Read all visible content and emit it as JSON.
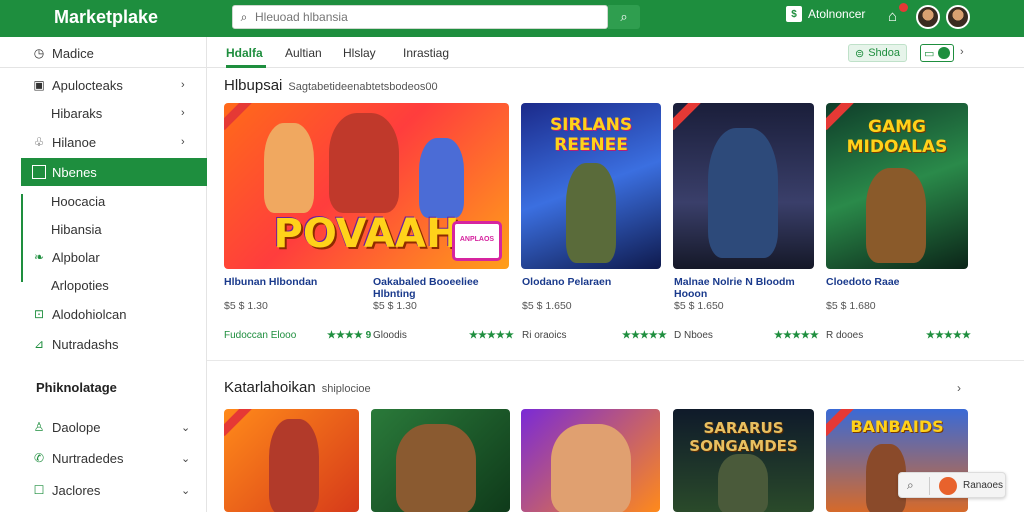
{
  "header": {
    "logo": "Marketplake",
    "search_placeholder": "Hleuoad hlbansia",
    "right_label": "Atolnoncer",
    "right_box": "$"
  },
  "sidebar": {
    "items": [
      {
        "label": "Madice",
        "icon": "clock-icon"
      },
      {
        "label": "Apulocteaks",
        "icon": "bag-icon"
      },
      {
        "label": "Hibaraks",
        "icon": ""
      },
      {
        "label": "Hilanoe",
        "icon": "puzzle-icon"
      },
      {
        "label": "Nbenes",
        "icon": "square-icon"
      },
      {
        "label": "Hoocacia",
        "icon": ""
      },
      {
        "label": "Hibansia",
        "icon": ""
      },
      {
        "label": "Alpbolar",
        "icon": "leaf-icon"
      },
      {
        "label": "Arlopoties",
        "icon": ""
      },
      {
        "label": "Alodohiolcan",
        "icon": "window-icon"
      },
      {
        "label": "Nutradashs",
        "icon": "chart-icon"
      }
    ],
    "heading": "Phiknolatage",
    "lower_items": [
      {
        "label": "Daolope",
        "icon": "person-icon"
      },
      {
        "label": "Nurtradedes",
        "icon": "phone-icon"
      },
      {
        "label": "Jaclores",
        "icon": "square-icon"
      }
    ]
  },
  "tabs": {
    "items": [
      "Hdalfa",
      "Aultian",
      "Hlslay",
      "Inrastiag"
    ],
    "pill_a": "Shdoa"
  },
  "section1": {
    "title": "Hlbupsai",
    "subtitle": "Sagtabetideenabtetsbodeos00",
    "cards": [
      {
        "art": "POVAAH",
        "badge": "ANPLAOS",
        "title": "Hlbunan Hlbondan",
        "price": "$5 $ 1.30",
        "meta": "Fudoccan Elooo",
        "stars": "★★★★ 9"
      },
      {
        "art": "SIRLANS REENEE",
        "title": "Oakabaled Booeeliee Hlbnting",
        "price": "$5 $ 1.30",
        "meta": "Gloodis",
        "stars": "★★★★★"
      },
      {
        "art": "",
        "title": "Olodano Pelaraen",
        "price": "$5 $ 1.650",
        "meta": "Ri oraoics",
        "stars": "★★★★★"
      },
      {
        "art": "",
        "title": "Malnae Nolrie N Bloodm Hooon",
        "price": "$5 $ 1.650",
        "meta": "D Nboes",
        "stars": "★★★★★"
      },
      {
        "art": "GAMG MIDOALAS",
        "title": "Cloedoto Raae",
        "price": "$5 $ 1.680",
        "meta": "R dooes",
        "stars": "★★★★★"
      }
    ]
  },
  "section2": {
    "title": "Katarlahoikan",
    "subtitle": "shiplocioe",
    "cards": [
      {
        "art": ""
      },
      {
        "art": ""
      },
      {
        "art": ""
      },
      {
        "art": "SARARUS SONGAMDES"
      },
      {
        "art": "BANBAIDS"
      }
    ]
  },
  "float_bar": {
    "label": "Ranaoes"
  }
}
